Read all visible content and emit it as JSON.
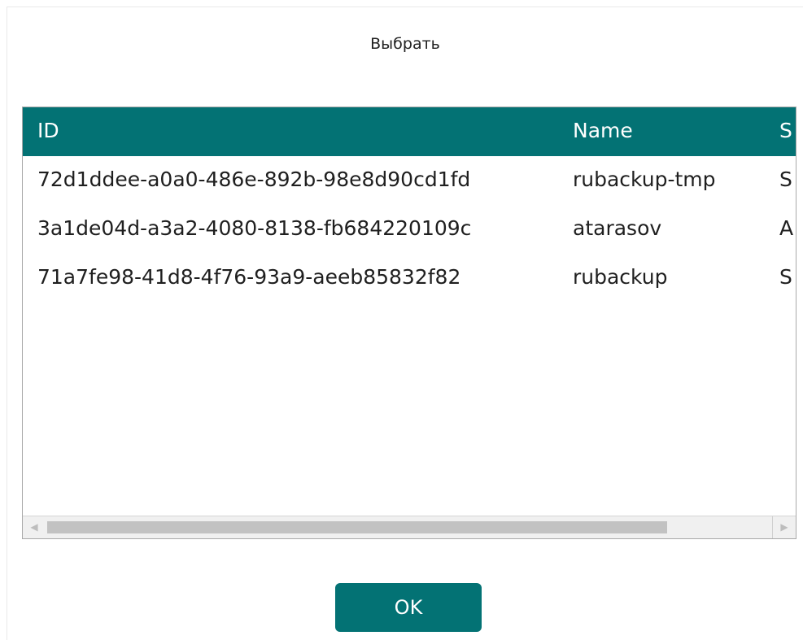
{
  "dialog": {
    "title": "Выбрать",
    "ok_label": "OK"
  },
  "table": {
    "columns": [
      "ID",
      "Name",
      "S"
    ],
    "rows": [
      {
        "id": "72d1ddee-a0a0-486e-892b-98e8d90cd1fd",
        "name": "rubackup-tmp",
        "s": "S"
      },
      {
        "id": "3a1de04d-a3a2-4080-8138-fb684220109c",
        "name": "atarasov",
        "s": "A"
      },
      {
        "id": "71a7fe98-41d8-4f76-93a9-aeeb85832f82",
        "name": "rubackup",
        "s": "S"
      }
    ]
  },
  "scrollbar": {
    "left_arrow": "◀",
    "right_arrow": "▶",
    "position": 0.0
  },
  "colors": {
    "accent": "#037274",
    "header_text": "#ffffff",
    "scroll_thumb": "#c2c2c2"
  }
}
